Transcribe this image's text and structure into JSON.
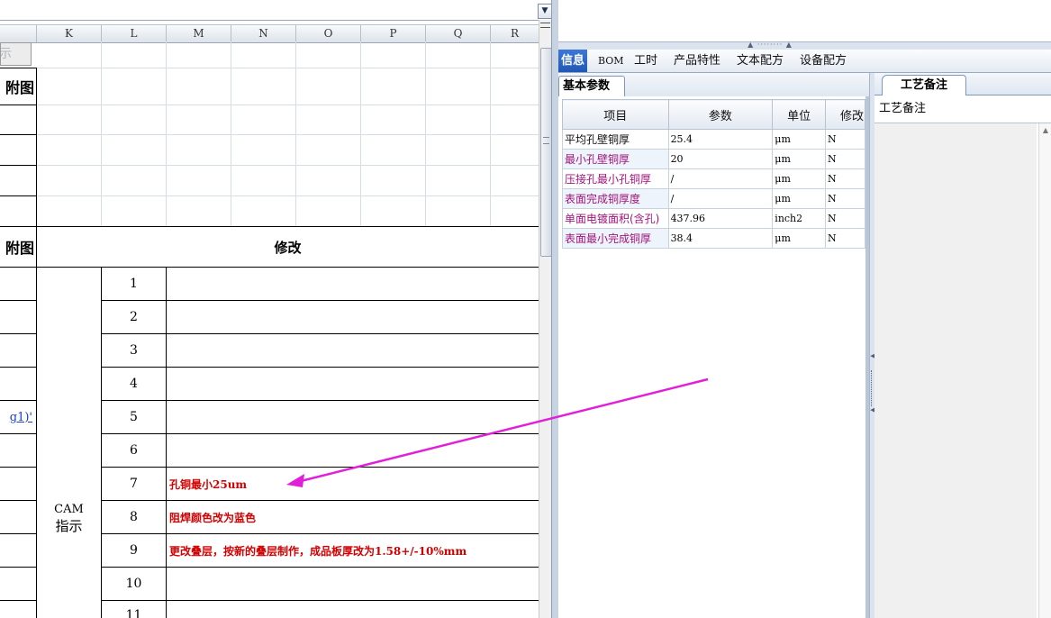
{
  "sheet": {
    "columns": [
      "K",
      "L",
      "M",
      "N",
      "O",
      "P",
      "Q",
      "R"
    ],
    "partial_button_label": "示",
    "attachment_label_1": "附图",
    "attachment_label_2": "附图",
    "modify_header": "修改",
    "cam_label_line1": "CAM",
    "cam_label_line2": "指示",
    "formula_fragment": "g1)'",
    "rows": [
      {
        "num": "1",
        "note": ""
      },
      {
        "num": "2",
        "note": ""
      },
      {
        "num": "3",
        "note": ""
      },
      {
        "num": "4",
        "note": ""
      },
      {
        "num": "5",
        "note": ""
      },
      {
        "num": "6",
        "note": ""
      },
      {
        "num": "7",
        "note": "孔铜最小25um"
      },
      {
        "num": "8",
        "note": "阻焊颜色改为蓝色"
      },
      {
        "num": "9",
        "note": "更改叠层，按新的叠层制作，成品板厚改为1.58+/-10%mm"
      },
      {
        "num": "10",
        "note": ""
      },
      {
        "num": "11",
        "note": ""
      }
    ]
  },
  "panel": {
    "tabs": [
      {
        "label": "信息",
        "active": true
      },
      {
        "label": "BOM",
        "active": false
      },
      {
        "label": "工时",
        "active": false
      },
      {
        "label": "产品特性",
        "active": false
      },
      {
        "label": "文本配方",
        "active": false
      },
      {
        "label": "设备配方",
        "active": false
      }
    ],
    "left_tab": "基本参数",
    "table_headers": {
      "item": "项目",
      "param": "参数",
      "unit": "单位",
      "mod": "修改"
    },
    "params": [
      {
        "item": "平均孔壁铜厚",
        "value": "25.4",
        "unit": "μm",
        "mod": "N"
      },
      {
        "item": "最小孔壁铜厚",
        "value": "20",
        "unit": "μm",
        "mod": "N"
      },
      {
        "item": "压接孔最小孔铜厚",
        "value": "/",
        "unit": "μm",
        "mod": "N"
      },
      {
        "item": "表面完成铜厚度",
        "value": "/",
        "unit": "μm",
        "mod": "N"
      },
      {
        "item": "单面电镀面积(含孔)",
        "value": "437.96",
        "unit": "inch2",
        "mod": "N"
      },
      {
        "item": "表面最小完成铜厚",
        "value": "38.4",
        "unit": "μm",
        "mod": "N"
      }
    ],
    "right_tab": "工艺备注",
    "right_header": "工艺备注"
  },
  "colors": {
    "note_red": "#d40000",
    "item_magenta": "#a0147a",
    "arrow_magenta": "#e21fd8",
    "tab_active_blue": "#2f6bcd"
  }
}
